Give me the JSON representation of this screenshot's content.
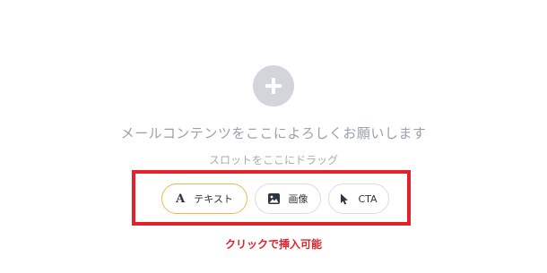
{
  "empty_state": {
    "headline": "メールコンテンツをここによろしくお願いします",
    "subline": "スロットをここにドラッグ"
  },
  "slot_options": [
    {
      "label": "テキスト",
      "icon": "text-letter-a-icon"
    },
    {
      "label": "画像",
      "icon": "image-icon"
    },
    {
      "label": "CTA",
      "icon": "cursor-arrow-icon"
    }
  ],
  "annotation": {
    "caption": "クリックで挿入可能"
  },
  "colors": {
    "accent_red": "#e2222b",
    "selected_border": "#e8b84f",
    "plus_circle": "#d3d5db",
    "muted_text": "#9aa0ab"
  }
}
